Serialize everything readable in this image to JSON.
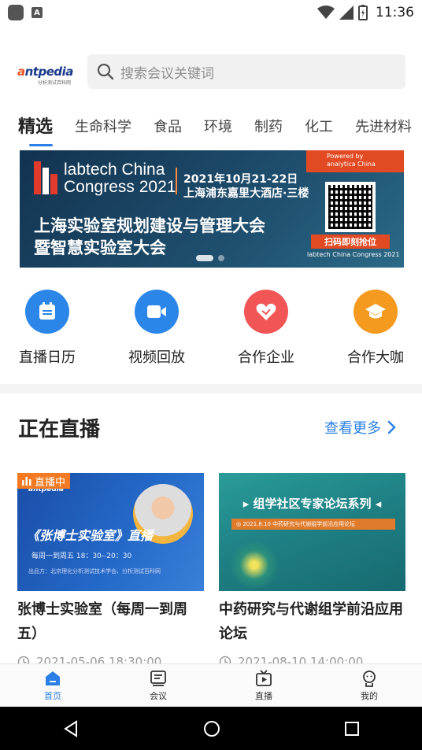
{
  "status_bar": {
    "time": "11:36"
  },
  "header": {
    "logo_text_a": "a",
    "logo_text_rest": "ntpedia",
    "logo_sub": "分析测试百科网",
    "search_placeholder": "搜索会议关键词"
  },
  "tabs": [
    "精选",
    "生命科学",
    "食品",
    "环境",
    "制药",
    "化工",
    "先进材料"
  ],
  "banner": {
    "brand_line1": "labtech China",
    "brand_line2": "Congress 2021",
    "date": "2021年10月21-22日",
    "venue": "上海浦东嘉里大酒店·三楼",
    "title_line1": "上海实验室规划建设与管理大会",
    "title_line2": "暨智慧实验室大会",
    "powered_line1": "Powered by",
    "powered_line2": "analytica China",
    "scan_text": "扫码即刻抢位",
    "footer": "labtech China Congress 2021"
  },
  "quick_nav": [
    {
      "label": "直播日历",
      "icon": "calendar-icon",
      "color": "#2b86e8"
    },
    {
      "label": "视频回放",
      "icon": "video-icon",
      "color": "#2b86e8"
    },
    {
      "label": "合作企业",
      "icon": "handshake-icon",
      "color": "#f15555"
    },
    {
      "label": "合作大咖",
      "icon": "graduation-cap-icon",
      "color": "#f39a1f"
    }
  ],
  "live_section": {
    "title": "正在直播",
    "more": "查看更多"
  },
  "cards": [
    {
      "badge": "直播中",
      "img_title": "《张博士实验室》直播",
      "img_sub": "每周一到周五   18：30--20：30",
      "img_org": "出品方：北京理化分析测试技术学会、分析测试百科网",
      "img_brand": "antpedia",
      "title": "张博士实验室（每周一到周五）",
      "time": "2021-05-06 18:30:00"
    },
    {
      "img_title": "▸ 组学社区专家论坛系列 ◂",
      "img_sub": "◎ 2021.8.10   中药研究与代谢组学前沿应用论坛",
      "title": "中药研究与代谢组学前沿应用论坛",
      "time": "2021-08-10 14:00:00"
    }
  ],
  "bottom_nav": [
    {
      "label": "首页",
      "icon": "home-icon",
      "active": true
    },
    {
      "label": "会议",
      "icon": "meeting-icon",
      "active": false
    },
    {
      "label": "直播",
      "icon": "live-icon",
      "active": false
    },
    {
      "label": "我的",
      "icon": "profile-icon",
      "active": false
    }
  ],
  "colors": {
    "accent": "#2b7fe6",
    "live_badge": "#f37a22"
  }
}
